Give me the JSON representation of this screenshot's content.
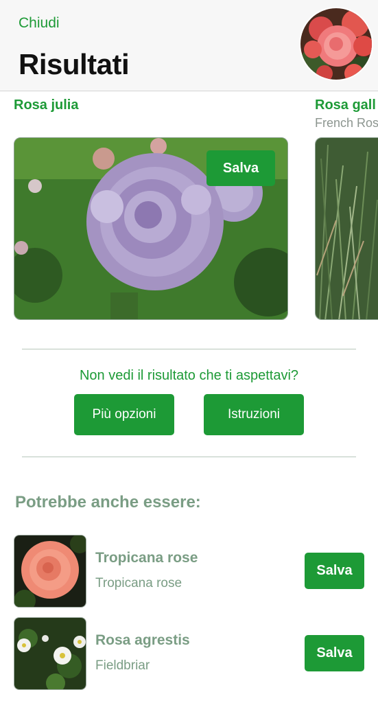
{
  "header": {
    "close_label": "Chiudi",
    "title": "Risultati"
  },
  "cards": [
    {
      "name": "Rosa julia",
      "common_name": "",
      "save_label": "Salva"
    },
    {
      "name": "Rosa gall",
      "common_name": "French Ros"
    }
  ],
  "feedback": {
    "question": "Non vedi il risultato che ti aspettavi?",
    "more_options_label": "Più opzioni",
    "instructions_label": "Istruzioni"
  },
  "alternatives": {
    "heading": "Potrebbe anche essere:",
    "items": [
      {
        "name": "Tropicana rose",
        "common_name": "Tropicana rose",
        "save_label": "Salva"
      },
      {
        "name": "Rosa agrestis",
        "common_name": "Fieldbriar",
        "save_label": "Salva"
      }
    ]
  },
  "colors": {
    "accent": "#1d9a36",
    "muted_green": "#7a9d84",
    "header_bg": "#f7f7f7"
  }
}
